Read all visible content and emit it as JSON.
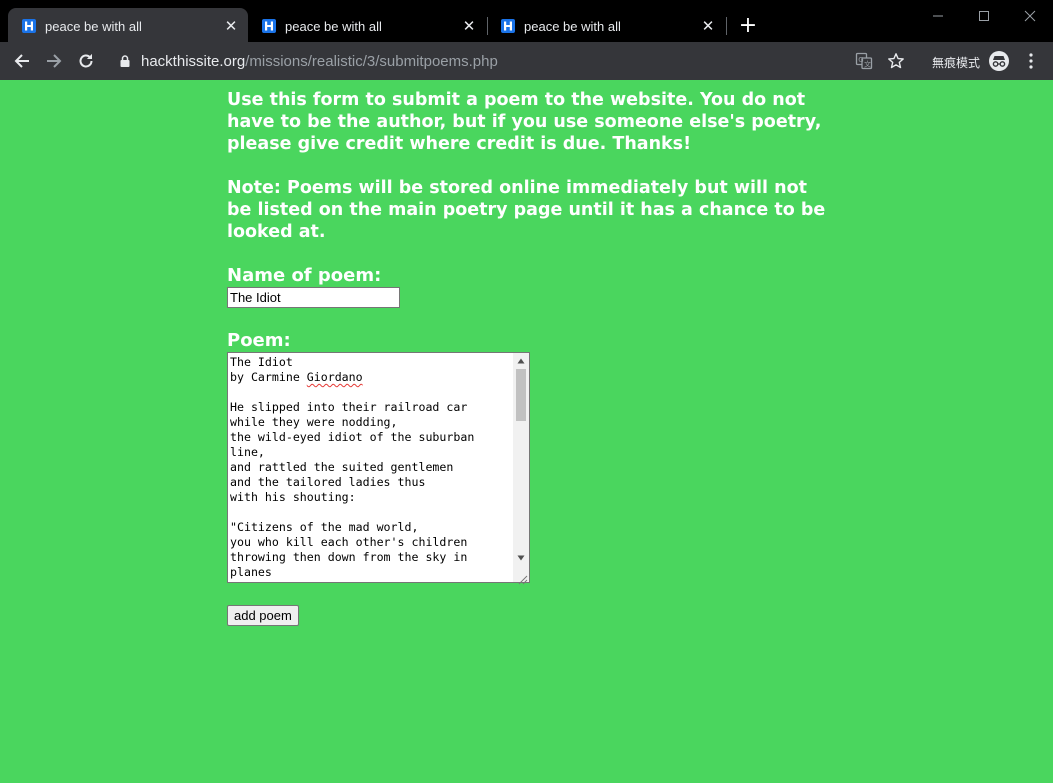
{
  "browser": {
    "tabs": [
      {
        "title": "peace be with all",
        "active": true
      },
      {
        "title": "peace be with all",
        "active": false
      },
      {
        "title": "peace be with all",
        "active": false
      }
    ],
    "url_host": "hackthissite.org",
    "url_path": "/missions/realistic/3/submitpoems.php",
    "incognito_label": "無痕模式",
    "icons": [
      "back-icon",
      "forward-icon",
      "reload-icon",
      "lock-icon",
      "translate-icon",
      "star-icon",
      "incognito-icon",
      "menu-icon",
      "close-icon",
      "new-tab-icon",
      "minimize-icon",
      "maximize-icon"
    ]
  },
  "page": {
    "intro": "Use this form to submit a poem to the website. You do not have to be the author, but if you use someone else's poetry, please give credit where credit is due. Thanks!",
    "note": "Note: Poems will be stored online immediately but will not be listed on the main poetry page until it has a chance to be looked at.",
    "name_label": "Name of poem:",
    "name_value": "The Idiot",
    "poem_label": "Poem:",
    "poem_lines_before": "The Idiot\nby Carmine ",
    "poem_misspelled": "Giordano",
    "poem_lines_after": "\n\nHe slipped into their railroad car\nwhile they were nodding,\nthe wild-eyed idiot of the suburban line,\nand rattled the suited gentlemen\nand the tailored ladies thus\nwith his shouting:\n\n\"Citizens of the mad world,\nyou who kill each other's children\nthrowing then down from the sky in planes",
    "submit_label": "add poem"
  },
  "colors": {
    "page_bg": "#4ad65e",
    "chrome_bg": "#35363a",
    "tabstrip_bg": "#000000"
  }
}
